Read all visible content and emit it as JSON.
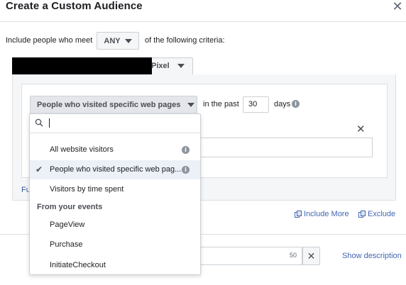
{
  "header": {
    "title": "Create a Custom Audience",
    "close_glyph": "✕"
  },
  "criteria": {
    "prefix": "Include people who meet",
    "match_value": "ANY",
    "suffix": "of the following criteria:"
  },
  "source": {
    "label": "Pixel"
  },
  "rule": {
    "event_select": "People who visited specific web pages",
    "in_the_past": "in the past",
    "days_value": "30",
    "days_label": "days",
    "fu_link": "Fu",
    "remove_glyph": "✕"
  },
  "actions": {
    "include_more": "Include More",
    "exclude": "Exclude"
  },
  "footer": {
    "char_count": "50",
    "clear_glyph": "✕",
    "show_description": "Show description"
  },
  "dropdown": {
    "search_value": "",
    "items": [
      {
        "label": "All website visitors",
        "selected": false,
        "info": true
      },
      {
        "label": "People who visited specific web pag...",
        "selected": true,
        "info": true
      },
      {
        "label": "Visitors by time spent",
        "selected": false,
        "info": false
      }
    ],
    "heading": "From your events",
    "events": [
      "PageView",
      "Purchase",
      "InitiateCheckout"
    ]
  },
  "colors": {
    "link": "#4267b2",
    "selected_row": "#ecf0f7",
    "panel": "#f5f6f7"
  }
}
